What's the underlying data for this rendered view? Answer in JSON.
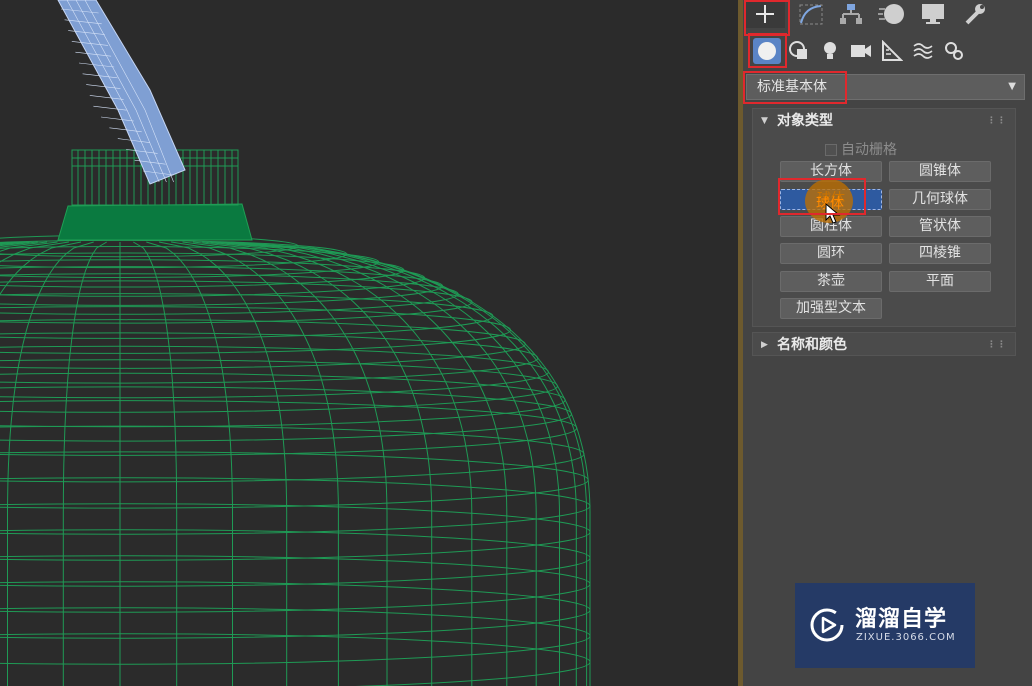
{
  "command_panel": {
    "tabs": [
      "create-tab",
      "modify-tab",
      "hierarchy-tab",
      "motion-tab",
      "display-tab",
      "utilities-tab"
    ],
    "sub_tabs": [
      "geometry-icon",
      "shapes-icon",
      "lights-icon",
      "cameras-icon",
      "helpers-icon",
      "space-warps-icon",
      "systems-icon"
    ],
    "category_dropdown": "标准基本体",
    "object_type": {
      "title": "对象类型",
      "autogrid_label": "自动栅格",
      "buttons": [
        "长方体",
        "圆锥体",
        "球体",
        "几何球体",
        "圆柱体",
        "管状体",
        "圆环",
        "四棱锥",
        "茶壶",
        "平面",
        "加强型文本"
      ],
      "selected": "球体"
    },
    "name_color": {
      "title": "名称和颜色"
    }
  },
  "watermark": {
    "brand": "溜溜自学",
    "url": "ZIXUE.3066.COM"
  },
  "colors": {
    "wireframe": "#1f9a55",
    "neck": "#0a7a40",
    "handle": "#a9c3ef",
    "highlight": "#e0282d",
    "panel_bg": "#444444",
    "viewport_bg": "#2b2b2b"
  }
}
